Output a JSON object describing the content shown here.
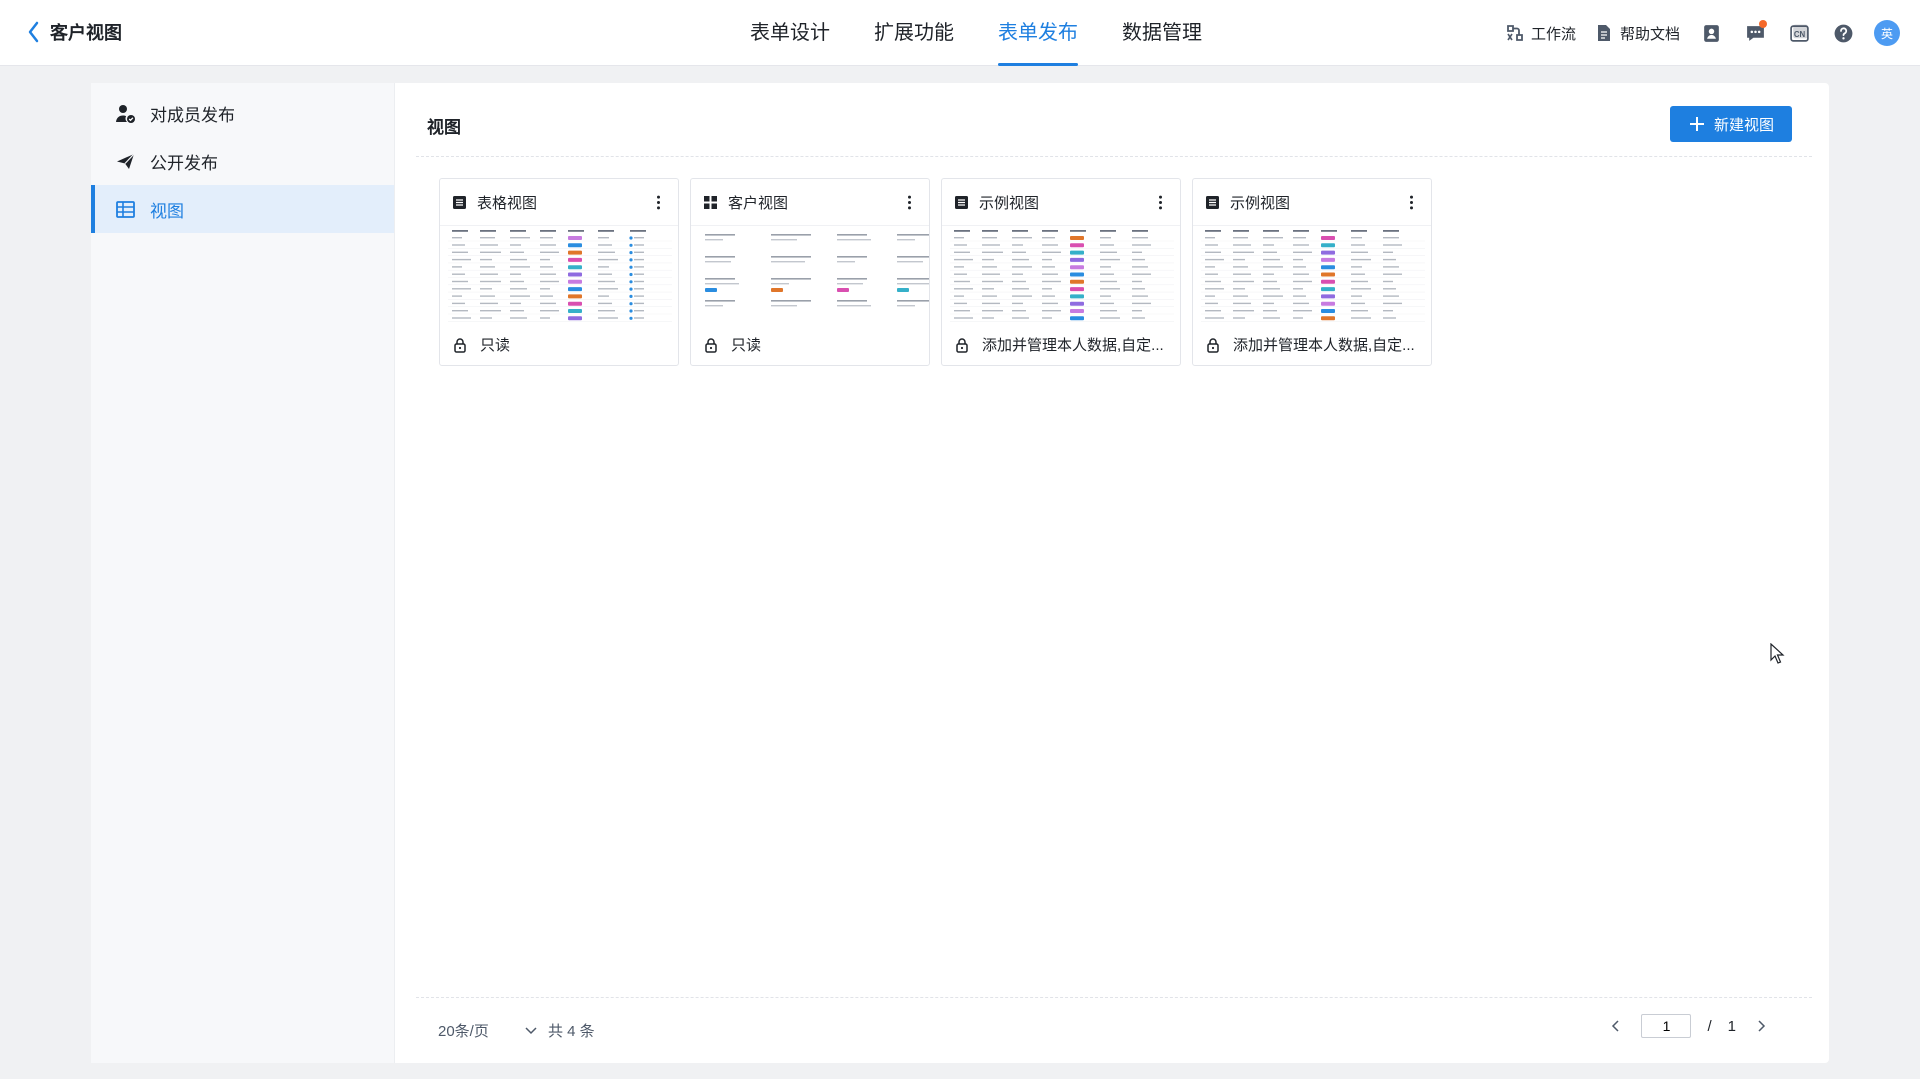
{
  "header": {
    "back_title": "客户视图",
    "tabs": [
      {
        "label": "表单设计"
      },
      {
        "label": "扩展功能"
      },
      {
        "label": "表单发布",
        "active": true
      },
      {
        "label": "数据管理"
      }
    ],
    "tools": {
      "workflow_label": "工作流",
      "help_label": "帮助文档",
      "lang_label": "CN",
      "avatar_text": "英"
    },
    "accent_color": "#1e7fe0",
    "notification_dot_color": "#f5692a"
  },
  "sidebar": {
    "items": [
      {
        "label": "对成员发布",
        "icon": "member-publish-icon"
      },
      {
        "label": "公开发布",
        "icon": "paper-plane-icon"
      },
      {
        "label": "视图",
        "icon": "table-grid-icon",
        "active": true
      }
    ]
  },
  "main": {
    "title": "视图",
    "new_button_label": "新建视图",
    "cards": [
      {
        "name": "表格视图",
        "type_icon": "list-icon",
        "permission": "只读"
      },
      {
        "name": "客户视图",
        "type_icon": "card-grid-icon",
        "permission": "只读"
      },
      {
        "name": "示例视图",
        "type_icon": "list-icon",
        "permission": "添加并管理本人数据,自定..."
      },
      {
        "name": "示例视图",
        "type_icon": "list-icon",
        "permission": "添加并管理本人数据,自定..."
      }
    ]
  },
  "footer": {
    "page_size": "20条/页",
    "total": "共 4 条",
    "current_page": "1",
    "separator": "/",
    "total_pages": "1"
  }
}
